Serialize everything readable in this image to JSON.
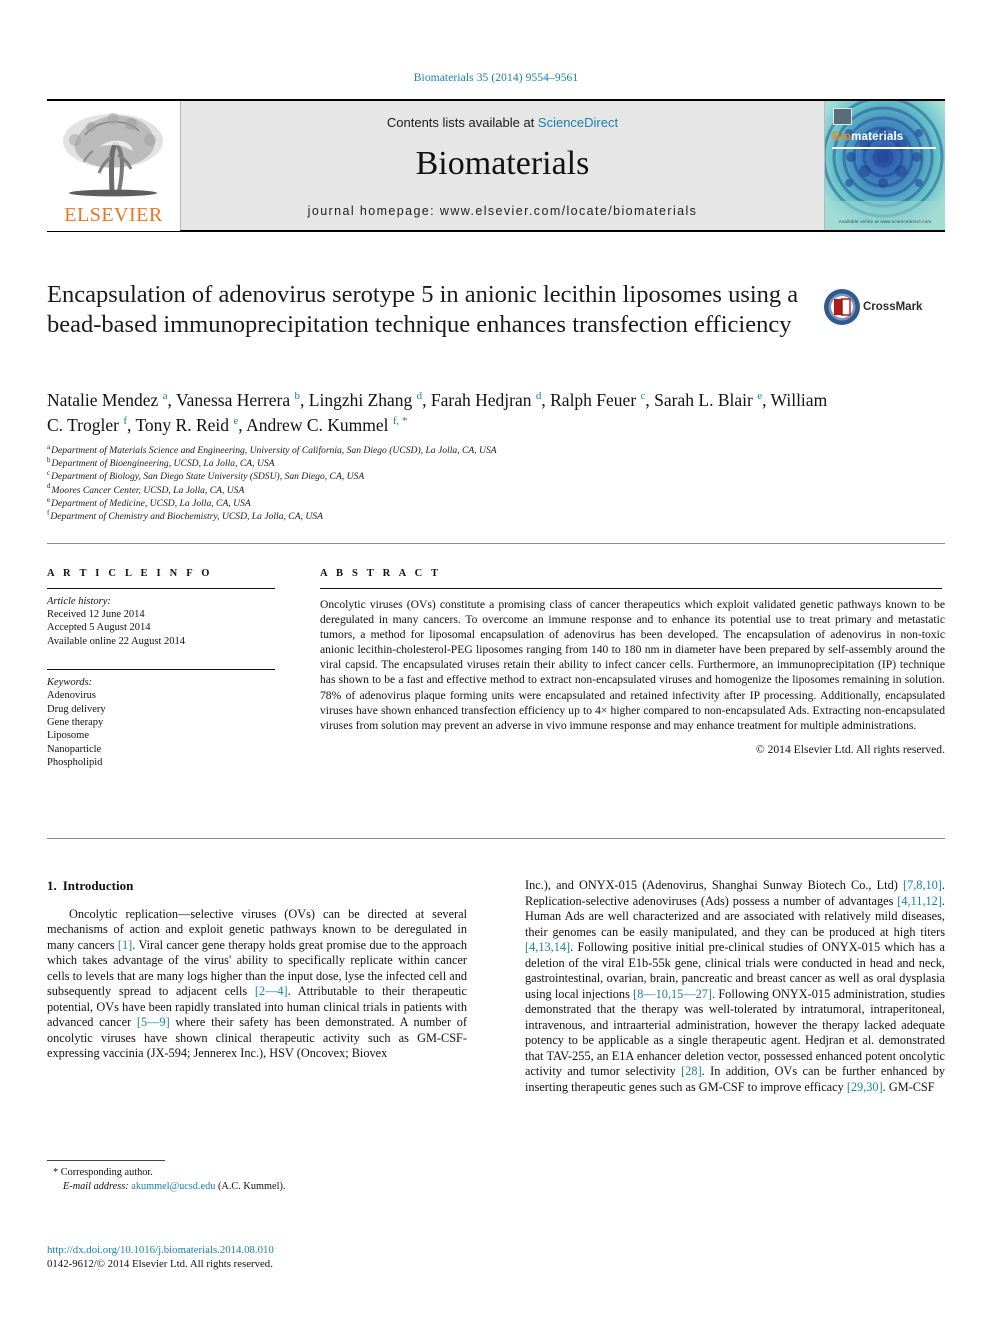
{
  "running_head": "Biomaterials 35 (2014) 9554–9561",
  "masthead": {
    "publisher_name": "ELSEVIER",
    "contents_prefix": "Contents lists available at ",
    "sciencedirect": "ScienceDirect",
    "journal_name": "Biomaterials",
    "homepage": "journal homepage: www.elsevier.com/locate/biomaterials",
    "cover_title_bio": "Bio",
    "cover_title_rest": "materials",
    "cover_footer": "Available online at www.sciencedirect.com"
  },
  "article": {
    "title": "Encapsulation of adenovirus serotype 5 in anionic lecithin liposomes using a bead-based immunoprecipitation technique enhances transfection efficiency",
    "crossmark_label": "CrossMark"
  },
  "authors": [
    {
      "name": "Natalie Mendez",
      "marks": "a",
      "sep": ", "
    },
    {
      "name": "Vanessa Herrera",
      "marks": "b",
      "sep": ", "
    },
    {
      "name": "Lingzhi Zhang",
      "marks": "d",
      "sep": ", "
    },
    {
      "name": "Farah Hedjran",
      "marks": "d",
      "sep": ", "
    },
    {
      "name": "Ralph Feuer",
      "marks": "c",
      "sep": ", "
    },
    {
      "name": "Sarah L. Blair",
      "marks": "e",
      "sep": ", "
    },
    {
      "name": "William C. Trogler",
      "marks": "f",
      "sep": ", "
    },
    {
      "name": "Tony R. Reid",
      "marks": "e",
      "sep": ", "
    },
    {
      "name": "Andrew C. Kummel",
      "marks": "f, *",
      "sep": ""
    }
  ],
  "affiliations": [
    {
      "label": "a",
      "text": "Department of Materials Science and Engineering, University of California, San Diego (UCSD), La Jolla, CA, USA"
    },
    {
      "label": "b",
      "text": "Department of Bioengineering, UCSD, La Jolla, CA, USA"
    },
    {
      "label": "c",
      "text": "Department of Biology, San Diego State University (SDSU), San Diego, CA, USA"
    },
    {
      "label": "d",
      "text": "Moores Cancer Center, UCSD, La Jolla, CA, USA"
    },
    {
      "label": "e",
      "text": "Department of Medicine, UCSD, La Jolla, CA, USA"
    },
    {
      "label": "f",
      "text": "Department of Chemistry and Biochemistry, UCSD, La Jolla, CA, USA"
    }
  ],
  "article_info": {
    "heading": "A R T I C L E   I N F O",
    "history_label": "Article history:",
    "history": [
      "Received 12 June 2014",
      "Accepted 5 August 2014",
      "Available online 22 August 2014"
    ],
    "keywords_label": "Keywords:",
    "keywords": [
      "Adenovirus",
      "Drug delivery",
      "Gene therapy",
      "Liposome",
      "Nanoparticle",
      "Phospholipid"
    ]
  },
  "abstract": {
    "heading": "A B S T R A C T",
    "body": "Oncolytic viruses (OVs) constitute a promising class of cancer therapeutics which exploit validated genetic pathways known to be deregulated in many cancers. To overcome an immune response and to enhance its potential use to treat primary and metastatic tumors, a method for liposomal encapsulation of adenovirus has been developed. The encapsulation of adenovirus in non-toxic anionic lecithin-cholesterol-PEG liposomes ranging from 140 to 180 nm in diameter have been prepared by self-assembly around the viral capsid. The encapsulated viruses retain their ability to infect cancer cells. Furthermore, an immunoprecipitation (IP) technique has shown to be a fast and effective method to extract non-encapsulated viruses and homogenize the liposomes remaining in solution. 78% of adenovirus plaque forming units were encapsulated and retained infectivity after IP processing. Additionally, encapsulated viruses have shown enhanced transfection efficiency up to 4× higher compared to non-encapsulated Ads. Extracting non-encapsulated viruses from solution may prevent an adverse in vivo immune response and may enhance treatment for multiple administrations.",
    "copyright": "© 2014 Elsevier Ltd. All rights reserved."
  },
  "body": {
    "section_number": "1.",
    "section_title": "Introduction",
    "left_paragraph_part1": "Oncolytic replication—selective viruses (OVs) can be directed at several mechanisms of action and exploit genetic pathways known to be deregulated in many cancers ",
    "cit_1": "[1]",
    "left_paragraph_part2": ". Viral cancer gene therapy holds great promise due to the approach which takes advantage of the virus' ability to specifically replicate within cancer cells to levels that are many logs higher than the input dose, lyse the infected cell and subsequently spread to adjacent cells ",
    "cit_2_4": "[2—4]",
    "left_paragraph_part3": ". Attributable to their therapeutic potential, OVs have been rapidly translated into human clinical trials in patients with advanced cancer ",
    "cit_5_9": "[5—9]",
    "left_paragraph_part4": " where their safety has been demonstrated. A number of oncolytic viruses have shown clinical therapeutic activity such as GM-CSF-expressing vaccinia (JX-594; Jennerex Inc.), HSV (Oncovex; Biovex",
    "right_part1": "Inc.), and ONYX-015 (Adenovirus, Shanghai Sunway Biotech Co., Ltd) ",
    "cit_7_8_10": "[7,8,10]",
    "right_part2": ". Replication-selective adenoviruses (Ads) possess a number of advantages ",
    "cit_4_11_12": "[4,11,12]",
    "right_part3": ". Human Ads are well characterized and are associated with relatively mild diseases, their genomes can be easily manipulated, and they can be produced at high titers ",
    "cit_4_13_14": "[4,13,14]",
    "right_part4": ". Following positive initial pre-clinical studies of ONYX-015 which has a deletion of the viral E1b-55k gene, clinical trials were conducted in head and neck, gastrointestinal, ovarian, brain, pancreatic and breast cancer as well as oral dysplasia using local injections ",
    "cit_8_10_15_27": "[8—10,15—27]",
    "right_part5": ". Following ONYX-015 administration, studies demonstrated that the therapy was well-tolerated by intratumoral, intraperitoneal, intravenous, and intraarterial administration, however the therapy lacked adequate potency to be applicable as a single therapeutic agent. Hedjran et al. demonstrated that TAV-255, an E1A enhancer deletion vector, possessed enhanced potent oncolytic activity and tumor selectivity ",
    "cit_28": "[28]",
    "right_part6": ". In addition, OVs can be further enhanced by inserting therapeutic genes such as GM-CSF to improve efficacy ",
    "cit_29_30": "[29,30]",
    "right_part7": ". GM-CSF"
  },
  "footnote": {
    "corresponding": "* Corresponding author.",
    "email_label": "E-mail address:",
    "email": "akummel@ucsd.edu",
    "email_suffix": " (A.C. Kummel)."
  },
  "imprint": {
    "doi": "http://dx.doi.org/10.1016/j.biomaterials.2014.08.010",
    "issn": "0142-9612/© 2014 Elsevier Ltd. All rights reserved."
  },
  "colors": {
    "link": "#1a7fae",
    "elsevier_orange": "#E87722",
    "masthead_gray": "#e6e6e6"
  }
}
